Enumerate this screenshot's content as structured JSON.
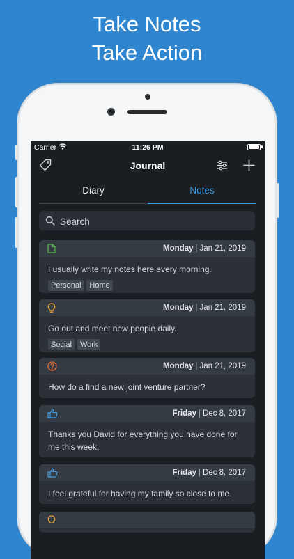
{
  "promo": {
    "line1": "Take Notes",
    "line2": "Take Action"
  },
  "status_bar": {
    "carrier": "Carrier",
    "time": "11:26 PM"
  },
  "nav": {
    "title": "Journal"
  },
  "tabs": [
    {
      "label": "Diary",
      "active": false
    },
    {
      "label": "Notes",
      "active": true
    }
  ],
  "search": {
    "placeholder": "Search",
    "value": ""
  },
  "colors": {
    "background": "#2f86cf",
    "screen": "#1a1d21",
    "accent": "#3a9ce6",
    "note_icon": "#55b24a",
    "idea_icon": "#e8a33a",
    "question_icon": "#e1632f",
    "thumb_icon": "#3a9ce6"
  },
  "notes": [
    {
      "icon": "document-icon",
      "day": "Monday",
      "date": "Jan 21, 2019",
      "text": "I usually write my notes here every morning.",
      "tags": [
        "Personal",
        "Home"
      ]
    },
    {
      "icon": "lightbulb-icon",
      "day": "Monday",
      "date": "Jan 21, 2019",
      "text": "Go out and meet new people daily.",
      "tags": [
        "Social",
        "Work"
      ]
    },
    {
      "icon": "question-icon",
      "day": "Monday",
      "date": "Jan 21, 2019",
      "text": "How do a find a new joint venture partner?",
      "tags": []
    },
    {
      "icon": "thumbs-up-icon",
      "day": "Friday",
      "date": "Dec 8, 2017",
      "text": "Thanks you David for everything you have done for me this week.",
      "tags": []
    },
    {
      "icon": "thumbs-up-icon",
      "day": "Friday",
      "date": "Dec 8, 2017",
      "text": "I feel grateful for having my family so close to me.",
      "tags": []
    }
  ]
}
